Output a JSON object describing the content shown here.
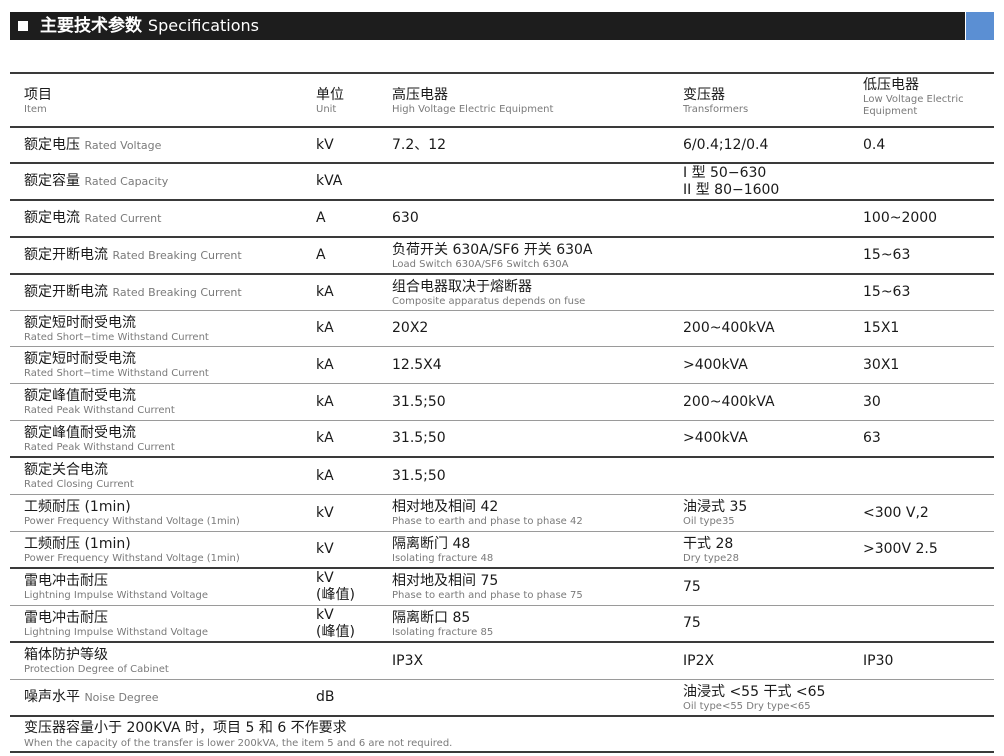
{
  "banner": {
    "title_zh": "主要技术参数",
    "title_en": "Specifications"
  },
  "header": {
    "item": {
      "zh": "项目",
      "en": "Item"
    },
    "unit": {
      "zh": "单位",
      "en": "Unit"
    },
    "hv": {
      "zh": "高压电器",
      "en": "High Voltage Electric Equipment"
    },
    "tr": {
      "zh": "变压器",
      "en": "Transformers"
    },
    "lv": {
      "zh": "低压电器",
      "en1": "Low Voltage Electric",
      "en2": "Equipment"
    }
  },
  "rows": [
    {
      "item_zh": "额定电压",
      "item_en": "Rated Voltage",
      "unit": "kV",
      "hv": "7.2、12",
      "tr": "6/0.4;12/0.4",
      "lv": "0.4"
    },
    {
      "item_zh": "额定容量",
      "item_en": "Rated Capacity",
      "unit": "kVA",
      "hv": "",
      "tr": "I 型 50−630",
      "tr2": "II 型 80−1600",
      "lv": ""
    },
    {
      "item_zh": "额定电流",
      "item_en": "Rated Current",
      "unit": "A",
      "hv": "630",
      "tr": "",
      "lv": "100~2000"
    },
    {
      "item_zh": "额定开断电流",
      "item_en": "Rated Breaking Current",
      "unit": "A",
      "hv": "负荷开关 630A/SF6 开关 630A",
      "hv_en": "Load Switch 630A/SF6 Switch 630A",
      "tr": "",
      "lv": "15~63"
    },
    {
      "item_zh": "额定开断电流",
      "item_en": "Rated Breaking Current",
      "unit": "kA",
      "hv": "组合电器取决于熔断器",
      "hv_en": "Composite apparatus depends on fuse",
      "tr": "",
      "lv": "15~63"
    },
    {
      "item_zh": "额定短时耐受电流",
      "item_en": "Rated Short−time Withstand Current",
      "unit": "kA",
      "hv": "20X2",
      "tr": "200~400kVA",
      "lv": "15X1"
    },
    {
      "item_zh": "额定短时耐受电流",
      "item_en": "Rated Short−time Withstand Current",
      "unit": "kA",
      "hv": "12.5X4",
      "tr": ">400kVA",
      "lv": "30X1"
    },
    {
      "item_zh": "额定峰值耐受电流",
      "item_en": "Rated Peak Withstand Current",
      "unit": "kA",
      "hv": "31.5;50",
      "tr": "200~400kVA",
      "lv": "30"
    },
    {
      "item_zh": "额定峰值耐受电流",
      "item_en": "Rated Peak Withstand Current",
      "unit": "kA",
      "hv": "31.5;50",
      "tr": ">400kVA",
      "lv": "63"
    },
    {
      "item_zh": "额定关合电流",
      "item_en": "Rated Closing Current",
      "unit": "kA",
      "hv": "31.5;50",
      "tr": "",
      "lv": ""
    },
    {
      "item_zh": "工频耐压 (1min)",
      "item_en": "Power Frequency Withstand Voltage (1min)",
      "unit": "kV",
      "hv": "相对地及相间 42",
      "hv_en": "Phase to earth and phase to phase 42",
      "tr": "油浸式 35",
      "tr_en": "Oil type35",
      "lv": "<300 V,2"
    },
    {
      "item_zh": "工频耐压 (1min)",
      "item_en": "Power Frequency Withstand Voltage (1min)",
      "unit": "kV",
      "hv": "隔离断门 48",
      "hv_en": "Isolating fracture 48",
      "tr": "干式 28",
      "tr_en": "Dry type28",
      "lv": ">300V 2.5"
    },
    {
      "item_zh": "雷电冲击耐压",
      "item_en": "Lightning Impulse Withstand Voltage",
      "unit": "kV",
      "unit2": "(峰值)",
      "hv": "相对地及相间 75",
      "hv_en": "Phase to earth and phase to phase 75",
      "tr": "75",
      "lv": ""
    },
    {
      "item_zh": "雷电冲击耐压",
      "item_en": "Lightning Impulse Withstand Voltage",
      "unit": "kV",
      "unit2": "(峰值)",
      "hv": "隔离断口 85",
      "hv_en": "Isolating fracture 85",
      "tr": "75",
      "lv": ""
    },
    {
      "item_zh": "箱体防护等级",
      "item_en": "Protection Degree of Cabinet",
      "unit": "",
      "hv": "IP3X",
      "tr": "IP2X",
      "lv": "IP30"
    },
    {
      "item_zh": "噪声水平",
      "item_en": "Noise Degree",
      "unit": "dB",
      "hv": "",
      "tr": "油浸式 <55 干式 <65",
      "tr_en": "Oil type<55 Dry type<65",
      "lv": ""
    }
  ],
  "note": {
    "zh": "变压器容量小于 200KVA 时，项目 5 和 6 不作要求",
    "en": "When the capacity of the transfer is lower 200kVA, the item 5 and 6 are not required."
  }
}
